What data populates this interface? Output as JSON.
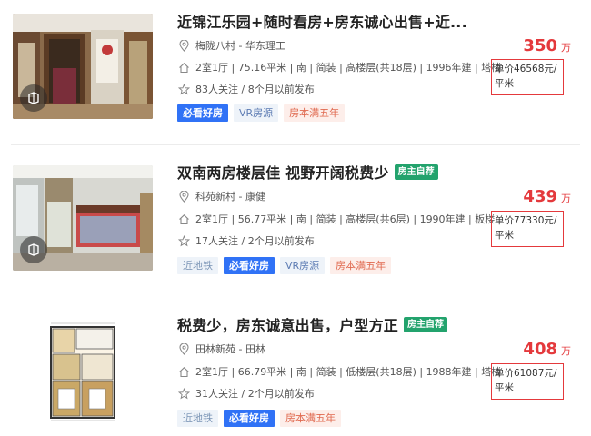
{
  "listings": [
    {
      "title": "近锦江乐园+随时看房+房东诚心出售+近...",
      "owner_tag": "",
      "location": "梅陇八村 - 华东理工",
      "details": "2室1厅 | 75.16平米 | 南 | 简装 | 高楼层(共18层) | 1996年建 | 塔楼",
      "followers": "83人关注 / 8个月以前发布",
      "tags": [
        "必看好房",
        "VR房源",
        "房本满五年"
      ],
      "price": "350",
      "price_unit": "万",
      "unit_price": "单价46568元/平米"
    },
    {
      "title": "双南两房楼层佳 视野开阔税费少",
      "owner_tag": "房主自荐",
      "location": "科苑新村 - 康健",
      "details": "2室1厅 | 56.77平米 | 南 | 简装 | 高楼层(共6层) | 1990年建 | 板楼",
      "followers": "17人关注 / 2个月以前发布",
      "tags": [
        "近地铁",
        "必看好房",
        "VR房源",
        "房本满五年"
      ],
      "price": "439",
      "price_unit": "万",
      "unit_price": "单价77330元/平米"
    },
    {
      "title": "税费少，房东诚意出售，户型方正",
      "owner_tag": "房主自荐",
      "location": "田林新苑 - 田林",
      "details": "2室1厅 | 66.79平米 | 南 | 简装 | 低楼层(共18层) | 1988年建 | 塔楼",
      "followers": "31人关注 / 2个月以前发布",
      "tags": [
        "近地铁",
        "必看好房",
        "房本满五年"
      ],
      "price": "408",
      "price_unit": "万",
      "unit_price": "单价61087元/平米"
    }
  ],
  "colors": {
    "price_red": "#e4393c",
    "owner_green": "#23a36d",
    "tag_blue": "#3072f6"
  },
  "icons": [
    "location-pin-icon",
    "house-icon",
    "star-icon",
    "vr-icon"
  ]
}
